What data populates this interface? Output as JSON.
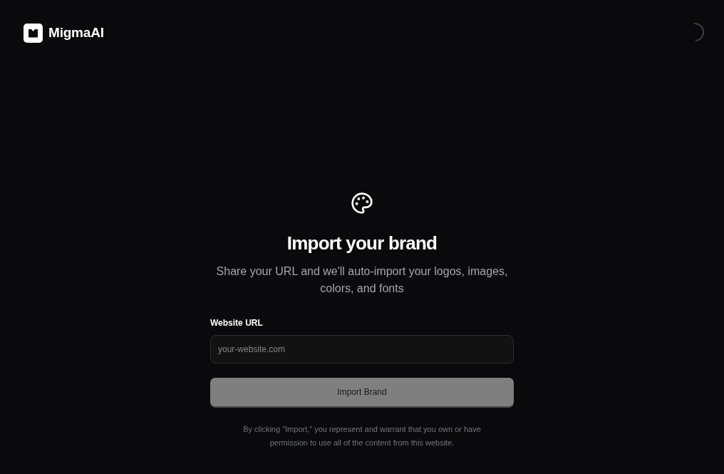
{
  "header": {
    "brand": "MigmaAI"
  },
  "hero": {
    "title": "Import your brand",
    "subtitle": "Share your URL and we'll auto-import your logos, images, colors, and fonts"
  },
  "form": {
    "url_field": {
      "label": "Website URL",
      "placeholder": "your-website.com"
    },
    "submit_button": {
      "label": "Import Brand",
      "disabled": true
    },
    "disclaimer": "By clicking \"Import,\" you represent and warrant that you own or have permission to use all of the content from this website."
  }
}
